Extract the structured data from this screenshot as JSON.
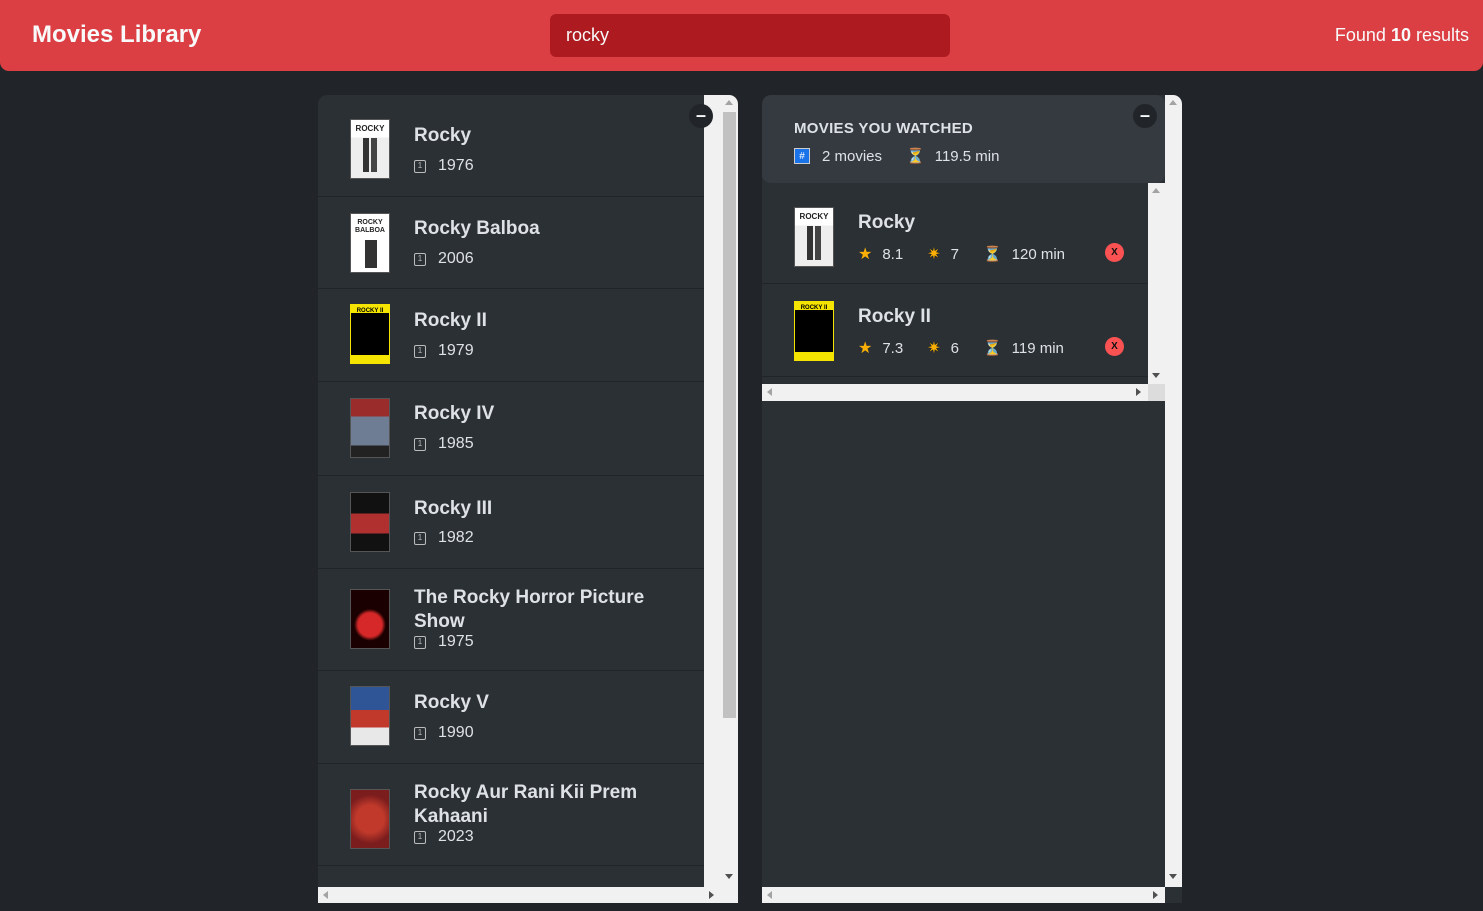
{
  "nav": {
    "logo": "Movies Library",
    "search_value": "rocky",
    "results_prefix": "Found",
    "results_count": "10",
    "results_suffix": "results"
  },
  "list": {
    "toggle_label": "–",
    "movies": [
      {
        "title": "Rocky",
        "year": "1976",
        "poster_colors": [
          "#ffffff",
          "#222222"
        ]
      },
      {
        "title": "Rocky Balboa",
        "year": "2006",
        "poster_colors": [
          "#ffffff",
          "#333333"
        ]
      },
      {
        "title": "Rocky II",
        "year": "1979",
        "poster_colors": [
          "#f5e400",
          "#000000"
        ]
      },
      {
        "title": "Rocky IV",
        "year": "1985",
        "poster_colors": [
          "#6e7d94",
          "#9b2c2c"
        ]
      },
      {
        "title": "Rocky III",
        "year": "1982",
        "poster_colors": [
          "#111111",
          "#b03030"
        ]
      },
      {
        "title": "The Rocky Horror Picture Show",
        "year": "1975",
        "poster_colors": [
          "#1a0000",
          "#d62828"
        ]
      },
      {
        "title": "Rocky V",
        "year": "1990",
        "poster_colors": [
          "#2f5597",
          "#c0392b"
        ]
      },
      {
        "title": "Rocky Aur Rani Kii Prem Kahaani",
        "year": "2023",
        "poster_colors": [
          "#c0392b",
          "#7b1d1d"
        ]
      }
    ]
  },
  "watched": {
    "toggle_label": "–",
    "summary_title": "MOVIES YOU WATCHED",
    "num_movies": "2 movies",
    "avg_runtime": "119.5 min",
    "hash_glyph": "#",
    "hourglass_glyph": "⏳",
    "movies": [
      {
        "title": "Rocky",
        "imdb_rating": "8.1",
        "user_rating": "7",
        "runtime": "120 min",
        "delete_label": "X",
        "poster_colors": [
          "#ffffff",
          "#222222"
        ]
      },
      {
        "title": "Rocky II",
        "imdb_rating": "7.3",
        "user_rating": "6",
        "runtime": "119 min",
        "delete_label": "X",
        "poster_colors": [
          "#f5e400",
          "#000000"
        ]
      }
    ]
  },
  "colors": {
    "accent": "#dc3f43",
    "background": "#212529",
    "box": "#2b3035",
    "summary": "#343a40",
    "delete": "#fa5252",
    "star": "#fab005"
  }
}
